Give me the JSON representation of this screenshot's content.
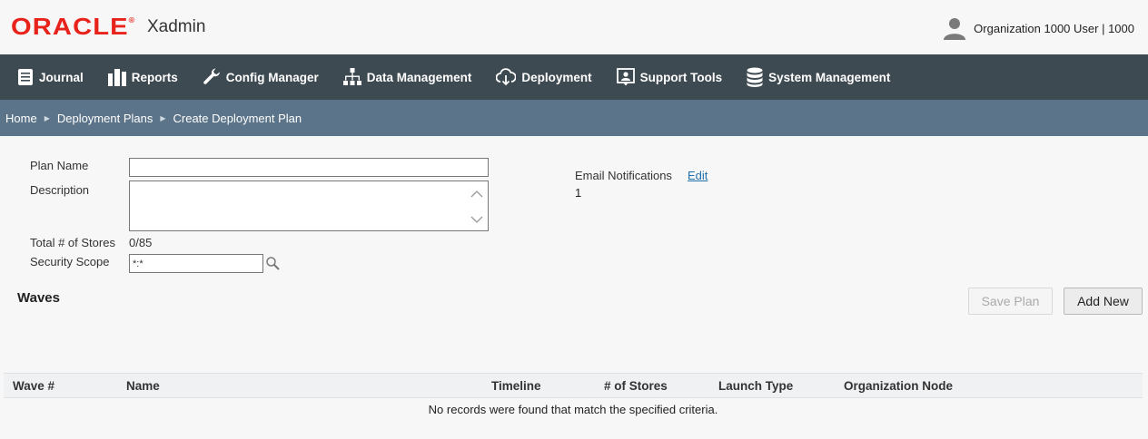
{
  "header": {
    "logo_text": "ORACLE",
    "logo_mark": "®",
    "app_name": "Xadmin",
    "user_label": "Organization 1000 User | 1000",
    "user_icon": "user-avatar-icon"
  },
  "nav": {
    "items": [
      {
        "label": "Journal",
        "icon": "journal-icon"
      },
      {
        "label": "Reports",
        "icon": "reports-icon"
      },
      {
        "label": "Config Manager",
        "icon": "wrench-icon"
      },
      {
        "label": "Data Management",
        "icon": "hierarchy-icon"
      },
      {
        "label": "Deployment",
        "icon": "cloud-download-icon"
      },
      {
        "label": "Support Tools",
        "icon": "support-icon"
      },
      {
        "label": "System Management",
        "icon": "database-icon"
      }
    ]
  },
  "breadcrumb": {
    "items": [
      "Home",
      "Deployment Plans",
      "Create Deployment Plan"
    ],
    "separator": "▶"
  },
  "form": {
    "plan_name_label": "Plan Name",
    "plan_name_value": "",
    "description_label": "Description",
    "description_value": "",
    "total_stores_label": "Total # of Stores",
    "total_stores_value": "0/85",
    "security_scope_label": "Security Scope",
    "security_scope_value": "*:*"
  },
  "email": {
    "label": "Email Notifications",
    "edit_label": "Edit",
    "count": "1"
  },
  "waves": {
    "title": "Waves",
    "save_label": "Save Plan",
    "add_label": "Add New",
    "columns": [
      "Wave #",
      "Name",
      "Timeline",
      "# of Stores",
      "Launch Type",
      "Organization Node"
    ],
    "empty_message": "No records were found that match the specified criteria."
  },
  "colors": {
    "brand": "#e8231b",
    "navbar": "#3e4a51",
    "breadcrumb": "#5c7489",
    "link": "#1f6fad"
  }
}
